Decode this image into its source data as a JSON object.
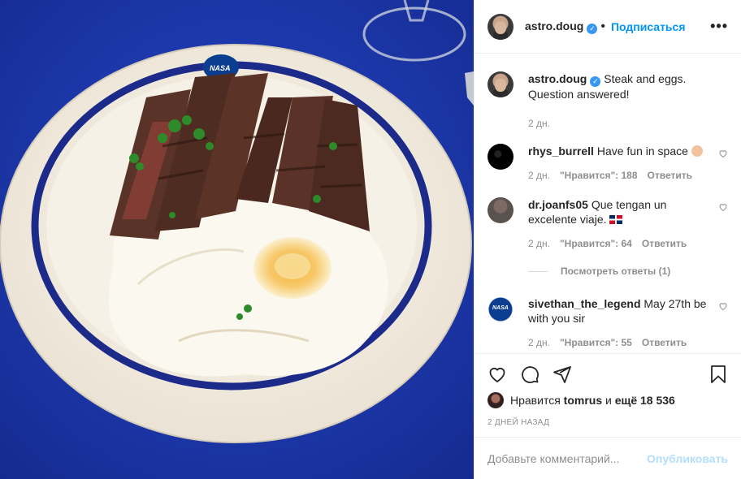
{
  "post": {
    "author": "astro.doug",
    "follow_label": "Подписаться",
    "more_label": "•••",
    "caption_text": "Steak and eggs. Question answered!",
    "caption_time": "2 дн."
  },
  "comments": [
    {
      "user": "rhys_burrell",
      "text": "Have fun in space",
      "time": "2 дн.",
      "likes": "\"Нравится\": 188",
      "reply": "Ответить"
    },
    {
      "user": "dr.joanfs05",
      "text": "Que tengan un excelente viaje.",
      "time": "2 дн.",
      "likes": "\"Нравится\": 64",
      "reply": "Ответить"
    },
    {
      "user": "sivethan_the_legend",
      "text": "May 27th be with you sir",
      "time": "2 дн.",
      "likes": "\"Нравится\": 55",
      "reply": "Ответить"
    }
  ],
  "view_replies": "Посмотреть ответы (1)",
  "likes_line": {
    "prefix": "Нравится",
    "user": "tomrus",
    "middle": "и",
    "rest": "ещё 18 536"
  },
  "date_label": "2 ДНЕЙ НАЗАД",
  "add_comment": {
    "placeholder": "Добавьте комментарий...",
    "publish_label": "Опубликовать"
  },
  "photo": {
    "plate_badge": "NASA"
  },
  "colors": {
    "accent": "#0095f6",
    "tablecloth": "#1f3cb5",
    "plate_rim": "#1c2a8a"
  }
}
